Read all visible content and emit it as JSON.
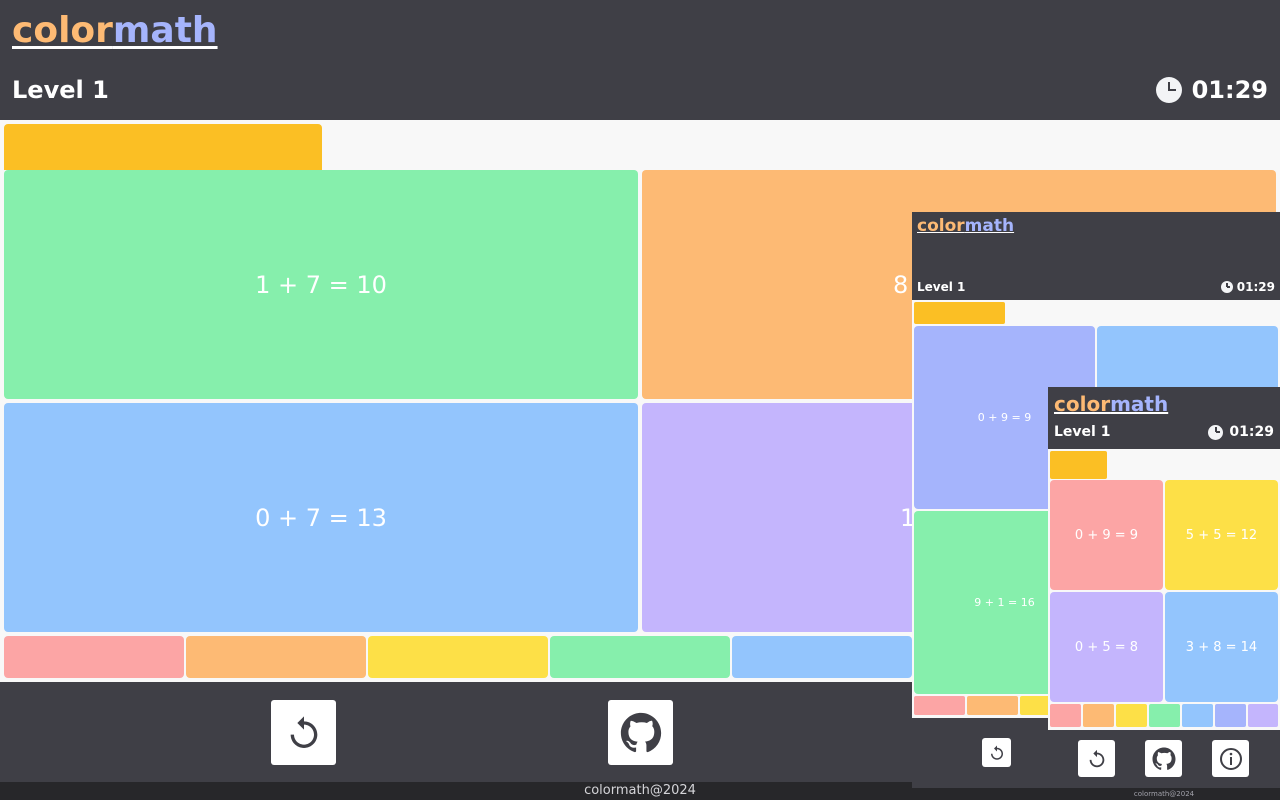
{
  "app": {
    "logo_part1": "color",
    "logo_part2": "math",
    "level_label": "Level 1",
    "timer": "01:29",
    "copyright": "colormath@2024"
  },
  "colors": {
    "header_bg": "#3f3f46",
    "logo_color": "#fdba74",
    "logo_math": "#a5b4fc",
    "target": "#fbbf24",
    "red": "#fca5a5",
    "orange": "#fdba74",
    "yellow": "#fde047",
    "green": "#86efac",
    "blue": "#93c5fd",
    "indigo": "#a5b4fc",
    "violet": "#c4b5fd"
  },
  "main_cards": [
    {
      "equation": "1 + 7 = 10",
      "color": "green"
    },
    {
      "equation": "8",
      "color": "orange"
    },
    {
      "equation": "0 + 7 = 13",
      "color": "blue"
    },
    {
      "equation": "1",
      "color": "violet"
    }
  ],
  "palette": [
    "red",
    "orange",
    "yellow",
    "green",
    "blue"
  ],
  "preview1": {
    "cards": [
      {
        "equation": "0 + 9 = 9",
        "color": "indigo"
      },
      {
        "equation": "",
        "color": "blue"
      },
      {
        "equation": "9 + 1 = 16",
        "color": "green"
      }
    ],
    "palette": [
      "red",
      "orange",
      "yellow"
    ]
  },
  "preview2": {
    "cards": [
      {
        "equation": "0 + 9 = 9",
        "color": "red"
      },
      {
        "equation": "5 + 5 = 12",
        "color": "yellow"
      },
      {
        "equation": "0 + 5 = 8",
        "color": "violet"
      },
      {
        "equation": "3 + 8 = 14",
        "color": "blue"
      }
    ],
    "palette": [
      "red",
      "orange",
      "yellow",
      "green",
      "blue",
      "indigo",
      "violet"
    ]
  },
  "buttons": {
    "restart": "restart-icon",
    "github": "github-icon",
    "info": "info-icon"
  }
}
